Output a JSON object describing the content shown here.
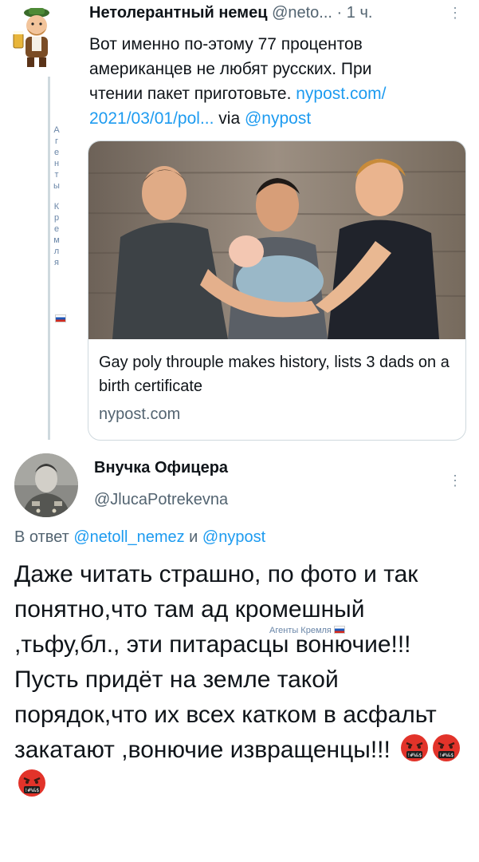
{
  "tweet1": {
    "author_name": "Нетолерантный немец",
    "handle": "@neto...",
    "separator": "·",
    "time": "1 ч.",
    "text_lines": [
      "Вот именно по-этому 77 процентов",
      "американцев не любят русских. При",
      "чтении пакет приготовьте. "
    ],
    "link_part1": "nypost.com/",
    "link_part2": "2021/03/01/pol...",
    "via_label": " via ",
    "via_handle": "@nypost",
    "card": {
      "title": "Gay poly throuple makes history, lists 3 dads on a birth certificate",
      "domain": "nypost.com"
    }
  },
  "watermark_vertical": [
    "А",
    "г",
    "е",
    "н",
    "т",
    "ы",
    "",
    "К",
    "р",
    "е",
    "м",
    "л",
    "я"
  ],
  "tweet2": {
    "author_name": "Внучка Офицера",
    "handle": "@JlucaPotrekevna",
    "reply_prefix": "В ответ ",
    "reply_to_1": "@netoll_nemez",
    "reply_and": " и ",
    "reply_to_2": "@nypost",
    "text": "Даже читать страшно, по фото и так понятно,что там ад кромешный ,тьфу,бл., эти питарасцы вонючие!!! Пусть придёт на земле такой порядок,что их всех катком в асфальт закатают ,вонючие извращенцы!!! ",
    "emoji_count": 3
  },
  "watermark2": "Агенты Кремля",
  "icons": {
    "more": "more-vertical-icon",
    "emoji": "angry-cursing-face-emoji"
  },
  "colors": {
    "link": "#1d9bf0",
    "secondary": "#536471",
    "border": "#cfd9de",
    "watermark": "#6a86a8"
  }
}
